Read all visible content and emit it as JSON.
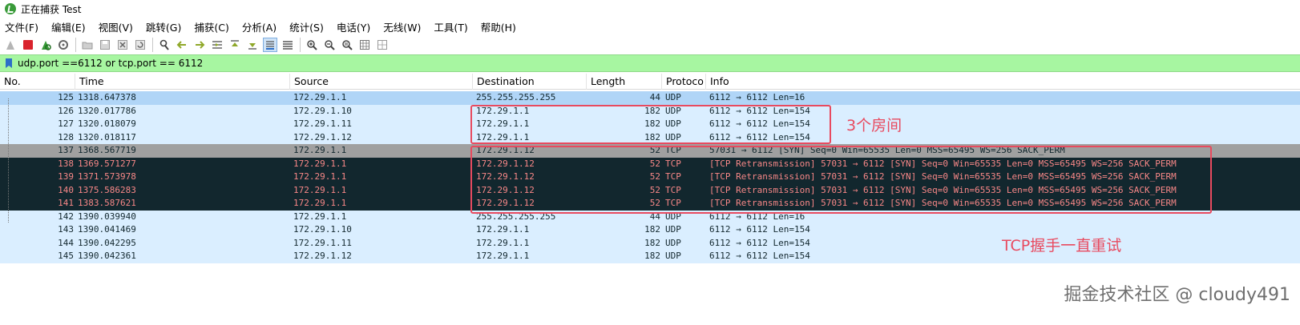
{
  "window": {
    "title": "正在捕获 Test"
  },
  "menu": [
    "文件(F)",
    "编辑(E)",
    "视图(V)",
    "跳转(G)",
    "捕获(C)",
    "分析(A)",
    "统计(S)",
    "电话(Y)",
    "无线(W)",
    "工具(T)",
    "帮助(H)"
  ],
  "toolbar": {
    "icons": [
      "shark-fin-start-icon",
      "stop-capture-icon",
      "restart-capture-icon",
      "capture-options-icon",
      "open-file-icon",
      "save-file-icon",
      "close-file-icon",
      "reload-icon",
      "find-packet-icon",
      "go-back-icon",
      "go-forward-icon",
      "go-to-packet-icon",
      "go-first-icon",
      "go-last-icon",
      "autoscroll-icon",
      "colorize-icon",
      "zoom-in-icon",
      "zoom-out-icon",
      "zoom-normal-icon",
      "resize-columns-icon",
      "layout-icon"
    ]
  },
  "filter": {
    "value": "udp.port ==6112 or tcp.port == 6112"
  },
  "columns": {
    "no": "No.",
    "time": "Time",
    "source": "Source",
    "destination": "Destination",
    "length": "Length",
    "protocol": "Protoco",
    "info": "Info"
  },
  "packets": [
    {
      "no": "125",
      "time": "1318.647378",
      "source": "172.29.1.1",
      "destination": "255.255.255.255",
      "length": "44",
      "protocol": "UDP",
      "info": "6112 → 6112 Len=16",
      "style": "udp sel"
    },
    {
      "no": "126",
      "time": "1320.017786",
      "source": "172.29.1.10",
      "destination": "172.29.1.1",
      "length": "182",
      "protocol": "UDP",
      "info": "6112 → 6112 Len=154",
      "style": "udp"
    },
    {
      "no": "127",
      "time": "1320.018079",
      "source": "172.29.1.11",
      "destination": "172.29.1.1",
      "length": "182",
      "protocol": "UDP",
      "info": "6112 → 6112 Len=154",
      "style": "udp"
    },
    {
      "no": "128",
      "time": "1320.018117",
      "source": "172.29.1.12",
      "destination": "172.29.1.1",
      "length": "182",
      "protocol": "UDP",
      "info": "6112 → 6112 Len=154",
      "style": "udp"
    },
    {
      "no": "137",
      "time": "1368.567719",
      "source": "172.29.1.1",
      "destination": "172.29.1.12",
      "length": "52",
      "protocol": "TCP",
      "info": "57031 → 6112 [SYN] Seq=0 Win=65535 Len=0 MSS=65495 WS=256 SACK_PERM",
      "style": "tcp-syn"
    },
    {
      "no": "138",
      "time": "1369.571277",
      "source": "172.29.1.1",
      "destination": "172.29.1.12",
      "length": "52",
      "protocol": "TCP",
      "info": "[TCP Retransmission] 57031 → 6112 [SYN] Seq=0 Win=65535 Len=0 MSS=65495 WS=256 SACK_PERM",
      "style": "tcp-bad"
    },
    {
      "no": "139",
      "time": "1371.573978",
      "source": "172.29.1.1",
      "destination": "172.29.1.12",
      "length": "52",
      "protocol": "TCP",
      "info": "[TCP Retransmission] 57031 → 6112 [SYN] Seq=0 Win=65535 Len=0 MSS=65495 WS=256 SACK_PERM",
      "style": "tcp-bad"
    },
    {
      "no": "140",
      "time": "1375.586283",
      "source": "172.29.1.1",
      "destination": "172.29.1.12",
      "length": "52",
      "protocol": "TCP",
      "info": "[TCP Retransmission] 57031 → 6112 [SYN] Seq=0 Win=65535 Len=0 MSS=65495 WS=256 SACK_PERM",
      "style": "tcp-bad"
    },
    {
      "no": "141",
      "time": "1383.587621",
      "source": "172.29.1.1",
      "destination": "172.29.1.12",
      "length": "52",
      "protocol": "TCP",
      "info": "[TCP Retransmission] 57031 → 6112 [SYN] Seq=0 Win=65535 Len=0 MSS=65495 WS=256 SACK_PERM",
      "style": "tcp-bad"
    },
    {
      "no": "142",
      "time": "1390.039940",
      "source": "172.29.1.1",
      "destination": "255.255.255.255",
      "length": "44",
      "protocol": "UDP",
      "info": "6112 → 6112 Len=16",
      "style": "udp"
    },
    {
      "no": "143",
      "time": "1390.041469",
      "source": "172.29.1.10",
      "destination": "172.29.1.1",
      "length": "182",
      "protocol": "UDP",
      "info": "6112 → 6112 Len=154",
      "style": "udp"
    },
    {
      "no": "144",
      "time": "1390.042295",
      "source": "172.29.1.11",
      "destination": "172.29.1.1",
      "length": "182",
      "protocol": "UDP",
      "info": "6112 → 6112 Len=154",
      "style": "udp"
    },
    {
      "no": "145",
      "time": "1390.042361",
      "source": "172.29.1.12",
      "destination": "172.29.1.1",
      "length": "182",
      "protocol": "UDP",
      "info": "6112 → 6112 Len=154",
      "style": "udp"
    }
  ],
  "annotations": {
    "rooms": "3个房间",
    "handshake": "TCP握手一直重试",
    "color": "#e84a5f"
  },
  "watermark": "掘金技术社区 @ cloudy491"
}
